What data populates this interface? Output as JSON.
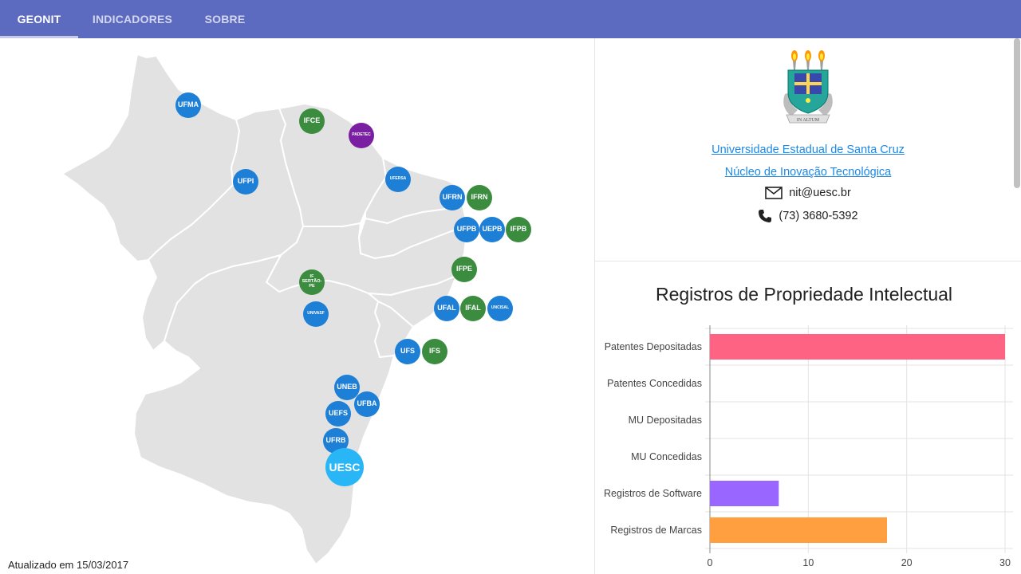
{
  "nav": {
    "tabs": [
      {
        "label": "GEONIT",
        "active": true
      },
      {
        "label": "INDICADORES",
        "active": false
      },
      {
        "label": "SOBRE",
        "active": false
      }
    ],
    "bar_color": "#5c6bc0"
  },
  "map": {
    "updated_text": "Atualizado em 15/03/2017",
    "colors": {
      "federal": "#1e7fd6",
      "institute": "#3c8c40",
      "other": "#7b1fa2",
      "selected": "#29b6f6"
    },
    "institutions": [
      {
        "label": "UFMA",
        "type": "federal"
      },
      {
        "label": "IFCE",
        "type": "institute"
      },
      {
        "label": "PADETEC",
        "type": "other"
      },
      {
        "label": "UFPI",
        "type": "federal"
      },
      {
        "label": "UFERSA",
        "type": "federal"
      },
      {
        "label": "UFRN",
        "type": "federal"
      },
      {
        "label": "IFRN",
        "type": "institute"
      },
      {
        "label": "UFPB",
        "type": "federal"
      },
      {
        "label": "UEPB",
        "type": "federal"
      },
      {
        "label": "IFPB",
        "type": "institute"
      },
      {
        "label": "IFPE",
        "type": "institute"
      },
      {
        "label": "IF SERTÃO-PE",
        "type": "institute"
      },
      {
        "label": "UNIVASF",
        "type": "federal"
      },
      {
        "label": "UFAL",
        "type": "federal"
      },
      {
        "label": "IFAL",
        "type": "institute"
      },
      {
        "label": "UNCISAL",
        "type": "federal"
      },
      {
        "label": "UFS",
        "type": "federal"
      },
      {
        "label": "IFS",
        "type": "institute"
      },
      {
        "label": "UNEB",
        "type": "federal"
      },
      {
        "label": "UFBA",
        "type": "federal"
      },
      {
        "label": "UEFS",
        "type": "federal"
      },
      {
        "label": "UFRB",
        "type": "federal"
      },
      {
        "label": "UESC",
        "type": "selected"
      }
    ]
  },
  "panel": {
    "university_link": "Universidade Estadual de Santa Cruz",
    "nit_link": "Núcleo de Inovação Tecnológica",
    "email": "nit@uesc.br",
    "phone": "(73) 3680-5392",
    "crest_text": "IN ALTUM"
  },
  "chart_data": {
    "type": "bar",
    "orientation": "horizontal",
    "title": "Registros de Propriedade Intelectual",
    "categories": [
      "Patentes Depositadas",
      "Patentes Concedidas",
      "MU Depositadas",
      "MU Concedidas",
      "Registros de Software",
      "Registros de Marcas"
    ],
    "values": [
      30,
      0,
      0,
      0,
      7,
      18
    ],
    "colors": [
      "#ff6384",
      "#36a2eb",
      "#4bc0c0",
      "#ffce56",
      "#9966ff",
      "#ff9f40"
    ],
    "xlim": [
      0,
      30
    ],
    "xticks": [
      0,
      10,
      20,
      30
    ],
    "grid": true,
    "xlabel": "",
    "ylabel": ""
  }
}
